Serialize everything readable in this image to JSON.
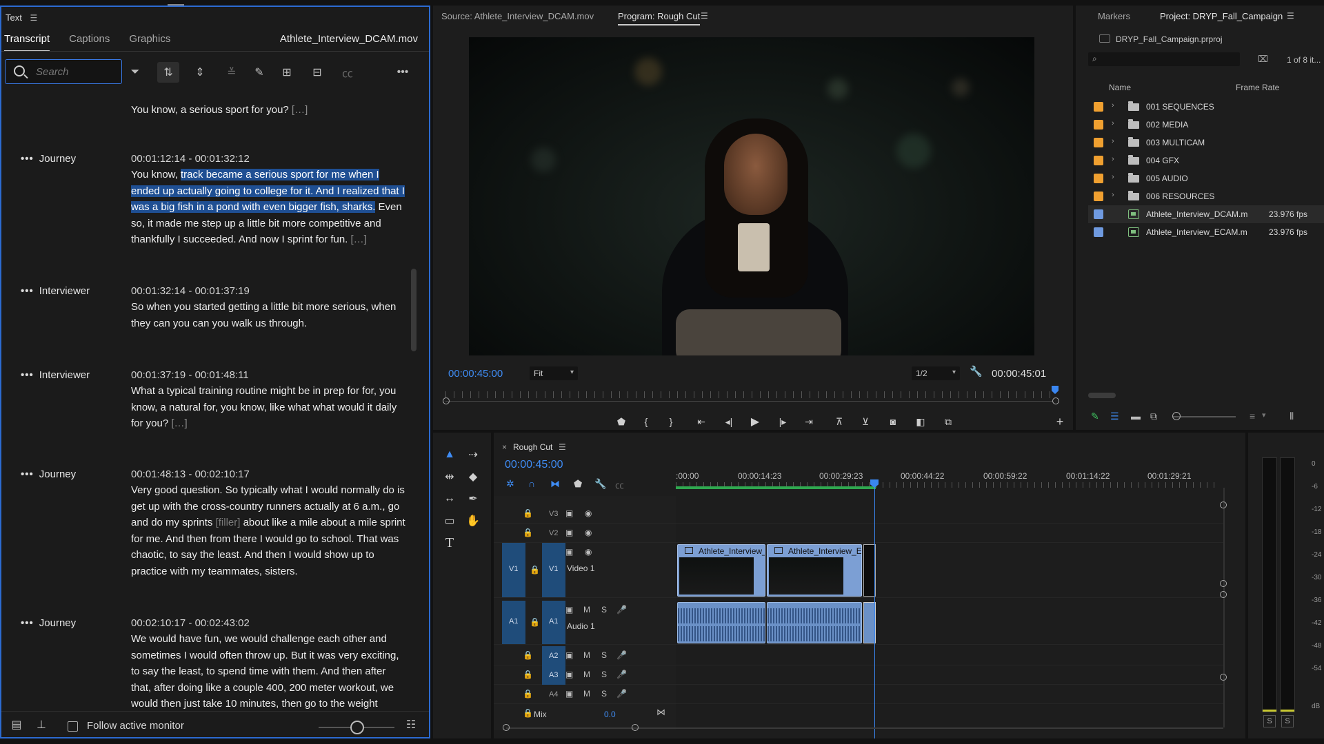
{
  "text_panel": {
    "title": "Text",
    "tabs": [
      "Transcript",
      "Captions",
      "Graphics"
    ],
    "active_tab": "Transcript",
    "clip_name": "Athlete_Interview_DCAM.mov",
    "search_placeholder": "Search",
    "follow_label": "Follow active monitor",
    "segments": [
      {
        "speaker": "",
        "time": "",
        "text_pre": "You know, a serious sport for you? ",
        "highlight": "",
        "text_post": "",
        "filler": "",
        "ellipsis": "[…]"
      },
      {
        "speaker": "Journey",
        "time": "00:01:12:14 - 00:01:32:12",
        "text_pre": "You know, ",
        "highlight": "track became a serious sport for me when I ended up actually going to college for it. And I realized that I was a big fish in a pond with even bigger fish, sharks.",
        "text_post": " Even so, it made me step up a little bit more competitive and thankfully I succeeded. And now I sprint for fun. ",
        "ellipsis": "[…]"
      },
      {
        "speaker": "Interviewer",
        "time": "00:01:32:14 - 00:01:37:19",
        "text_pre": "So when you started getting a little bit more serious, when they can you can you walk us through.",
        "highlight": "",
        "text_post": "",
        "ellipsis": ""
      },
      {
        "speaker": "Interviewer",
        "time": "00:01:37:19 - 00:01:48:11",
        "text_pre": "What a typical training routine might be in prep for for, you know, a natural for, you know, like what what would it daily for you? ",
        "highlight": "",
        "text_post": "",
        "ellipsis": "[…]"
      },
      {
        "speaker": "Journey",
        "time": "00:01:48:13 - 00:02:10:17",
        "text_pre": "Very good question. So typically what I would normally do is get up with the cross-country runners actually at 6 a.m., go and do my sprints ",
        "filler": "[filler]",
        "text_post": " about like a mile about a mile sprint for me. And then from there I would go to school. That was chaotic, to say the least. And then I would show up to practice with my teammates, sisters.",
        "highlight": "",
        "ellipsis": ""
      },
      {
        "speaker": "Journey",
        "time": "00:02:10:17 - 00:02:43:02",
        "text_pre": "We would have fun, we would challenge each other and sometimes I would often throw up. But it was very exciting, to say the least, to spend time with them. And then after that, after doing like a couple 400, 200 meter workout, we would then just take 10 minutes, then go to the weight room, lift a",
        "highlight": "",
        "text_post": "",
        "ellipsis": ""
      }
    ]
  },
  "program_monitor": {
    "source_tab": "Source: Athlete_Interview_DCAM.mov",
    "program_tab": "Program: Rough Cut",
    "current_tc": "00:00:45:00",
    "fit_option": "Fit",
    "resolution_option": "1/2",
    "duration_tc": "00:00:45:01"
  },
  "project_panel": {
    "tabs": [
      "Markers",
      "Project: DRYP_Fall_Campaign"
    ],
    "active_tab": "Project: DRYP_Fall_Campaign",
    "file": "DRYP_Fall_Campaign.prproj",
    "count": "1 of 8 it...",
    "col_name": "Name",
    "col_fps": "Frame Rate",
    "items": [
      {
        "name": "001 SEQUENCES",
        "fps": "",
        "kind": "folder",
        "color": "#f0a030"
      },
      {
        "name": "002 MEDIA",
        "fps": "",
        "kind": "folder",
        "color": "#f0a030"
      },
      {
        "name": "003 MULTICAM",
        "fps": "",
        "kind": "folder",
        "color": "#f0a030"
      },
      {
        "name": "004 GFX",
        "fps": "",
        "kind": "folder",
        "color": "#f0a030"
      },
      {
        "name": "005 AUDIO",
        "fps": "",
        "kind": "folder",
        "color": "#f0a030"
      },
      {
        "name": "006 RESOURCES",
        "fps": "",
        "kind": "folder",
        "color": "#f0a030"
      },
      {
        "name": "Athlete_Interview_DCAM.m",
        "fps": "23.976 fps",
        "kind": "clip",
        "color": "#6f9ae0"
      },
      {
        "name": "Athlete_Interview_ECAM.m",
        "fps": "23.976 fps",
        "kind": "clip",
        "color": "#6f9ae0"
      }
    ]
  },
  "timeline": {
    "sequence_name": "Rough Cut",
    "current_tc": "00:00:45:00",
    "ruler_labels": [
      ":00:00",
      "00:00:14:23",
      "00:00:29:23",
      "00:00:44:22",
      "00:00:59:22",
      "00:01:14:22",
      "00:01:29:21"
    ],
    "video_tracks": [
      "V3",
      "V2",
      "V1"
    ],
    "audio_tracks": [
      "A1",
      "A2",
      "A3",
      "A4"
    ],
    "video_track_name": "Video 1",
    "audio_track_name": "Audio 1",
    "mix_label": "Mix",
    "mix_value": "0.0",
    "clips": [
      "Athlete_Interview_ECAM.",
      "Athlete_Interview_ECAM.mo"
    ]
  },
  "meter": {
    "labels": [
      "0",
      "-6",
      "-12",
      "-18",
      "-24",
      "-30",
      "-36",
      "-42",
      "-48",
      "-54",
      "dB"
    ],
    "solo": [
      "S",
      "S"
    ]
  }
}
